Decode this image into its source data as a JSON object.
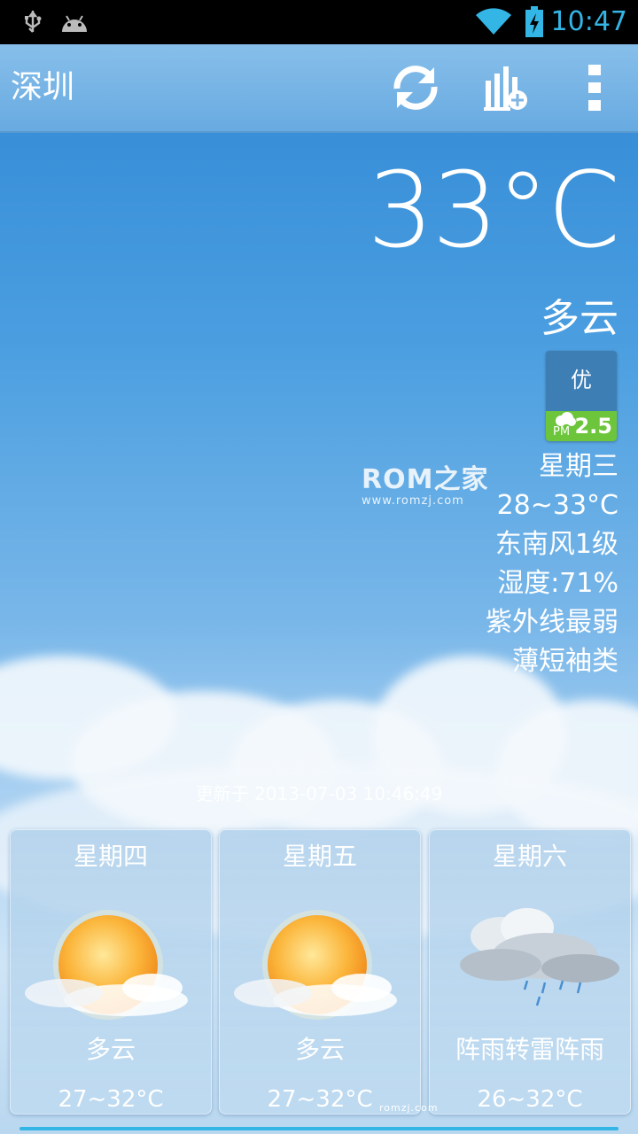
{
  "status_bar": {
    "time": "10:47",
    "icons": [
      "usb-icon",
      "android-debug-icon",
      "wifi-icon",
      "battery-charging-icon"
    ],
    "accent": "#33b5e5"
  },
  "action_bar": {
    "city": "深圳",
    "actions": [
      "refresh-icon",
      "add-chart-icon",
      "overflow-menu-icon"
    ]
  },
  "current": {
    "temperature": "33°C",
    "condition": "多云",
    "aqi": {
      "level": "优",
      "pm_label": "PM",
      "pm_value": "2.5",
      "level_color": "#6cc53a"
    },
    "weekday": "星期三",
    "range": "28~33°C",
    "wind": "东南风1级",
    "humidity": "湿度:71%",
    "uv": "紫外线最弱",
    "clothing": "薄短袖类"
  },
  "watermark": {
    "main": "ROM之家",
    "sub": "www.romzj.com",
    "small": "romzj.com"
  },
  "updated": "更新于 2013-07-03 10:46:49",
  "forecast": [
    {
      "day": "星期四",
      "icon": "sun-cloud-icon",
      "condition": "多云",
      "range": "27~32°C"
    },
    {
      "day": "星期五",
      "icon": "sun-cloud-icon",
      "condition": "多云",
      "range": "27~32°C"
    },
    {
      "day": "星期六",
      "icon": "thunder-rain-cloud-icon",
      "condition": "阵雨转雷阵雨",
      "range": "26~32°C"
    }
  ]
}
